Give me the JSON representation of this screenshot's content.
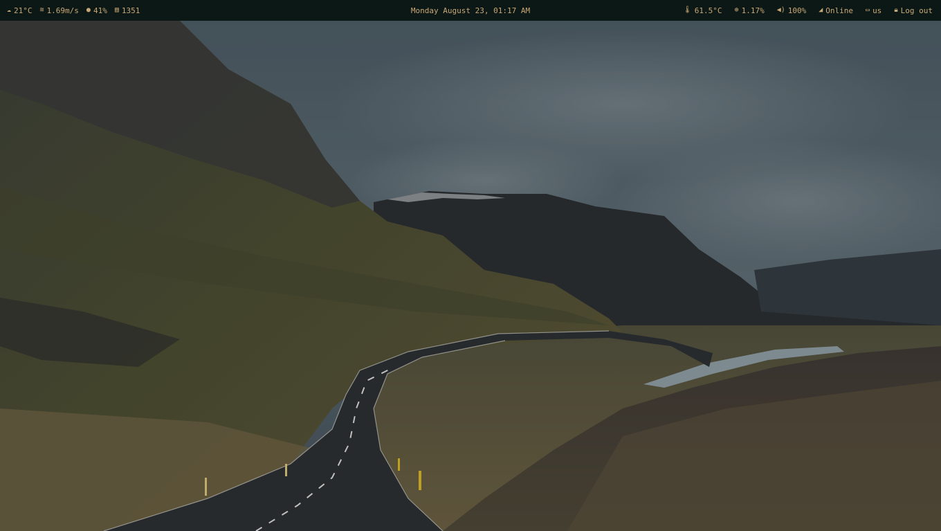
{
  "statusbar": {
    "weather": {
      "icon": "cloud-icon",
      "value": "21°C"
    },
    "wind": {
      "icon": "wind-icon",
      "value": "1.69m/s"
    },
    "humidity": {
      "icon": "droplet-icon",
      "value": "41%"
    },
    "updates": {
      "icon": "package-icon",
      "value": "1351"
    },
    "datetime": "Monday August 23, 01:17 AM",
    "cpu_temp": {
      "icon": "thermometer-icon",
      "value": "61.5°C"
    },
    "cpu_usage": {
      "icon": "cpu-icon",
      "value": "1.17%"
    },
    "volume": {
      "icon": "speaker-icon",
      "value": "100%"
    },
    "network": {
      "icon": "wifi-signal-icon",
      "value": "Online"
    },
    "keyboard": {
      "icon": "keyboard-icon",
      "value": "us"
    },
    "logout": {
      "icon": "lock-icon",
      "label": "Log out"
    }
  },
  "colors": {
    "bar_bg": "#0c1815",
    "bar_text": "#c9a877"
  }
}
